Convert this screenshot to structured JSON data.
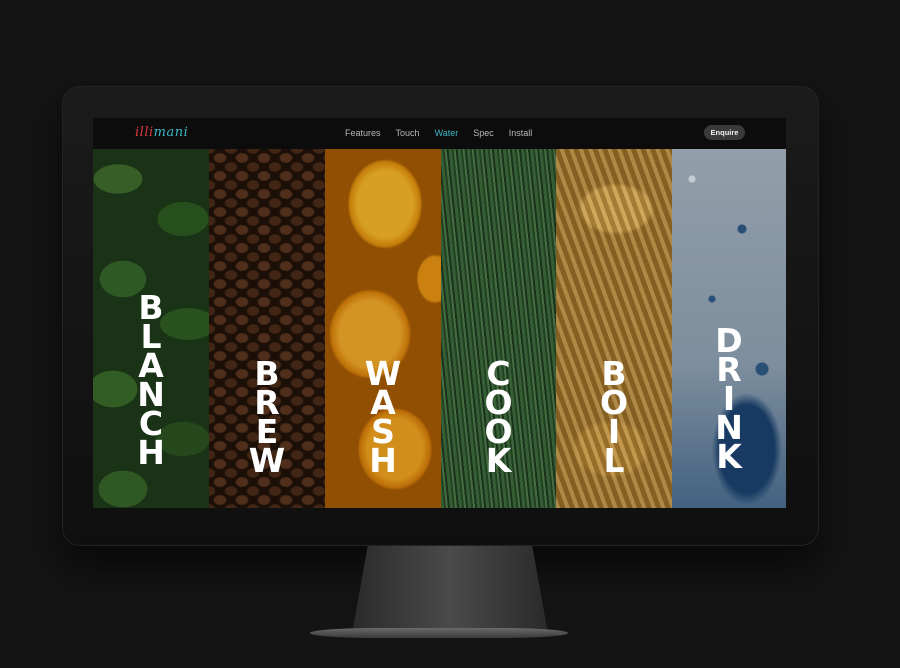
{
  "brand": {
    "logo_part1": "illi",
    "logo_part2": "mani"
  },
  "nav": {
    "items": [
      "Features",
      "Touch",
      "Water",
      "Spec",
      "Install"
    ],
    "active": "Water",
    "enquire_label": "Enquire"
  },
  "panels": [
    {
      "word": "BLANCH",
      "image": "spinach leaves"
    },
    {
      "word": "BREW",
      "image": "coffee beans"
    },
    {
      "word": "WASH",
      "image": "yellow peppers"
    },
    {
      "word": "COOK",
      "image": "green beans"
    },
    {
      "word": "BOIL",
      "image": "pasta"
    },
    {
      "word": "DRINK",
      "image": "water droplets"
    }
  ],
  "colors": {
    "accent": "#3fb6c8",
    "logo_red": "#d83a3a",
    "nav_bg": "#0c0c0c",
    "page_bg": "#141414"
  }
}
